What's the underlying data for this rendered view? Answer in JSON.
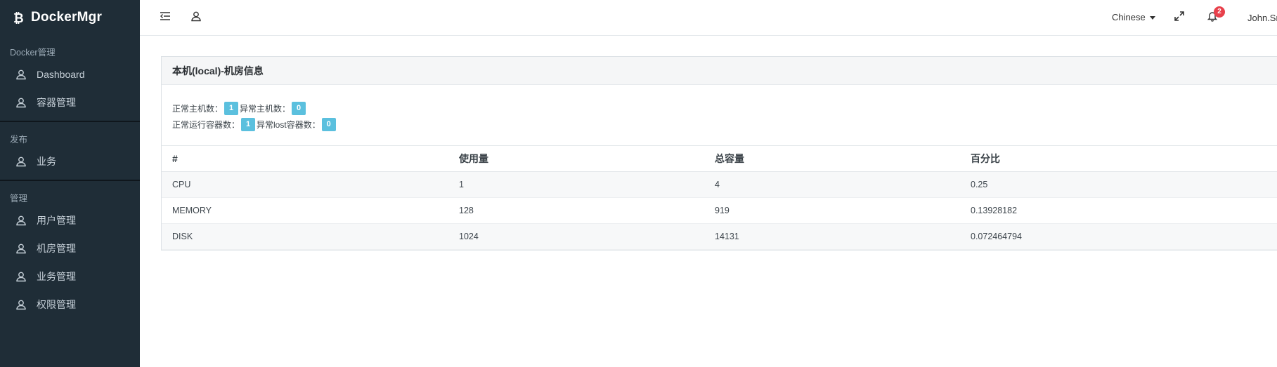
{
  "app": {
    "brand": "DockerMgr"
  },
  "sidebar": {
    "sections": [
      {
        "heading": "Docker管理",
        "items": [
          "Dashboard",
          "容器管理"
        ]
      },
      {
        "heading": "发布",
        "items": [
          "业务"
        ]
      },
      {
        "heading": "管理",
        "items": [
          "用户管理",
          "机房管理",
          "业务管理",
          "权限管理"
        ]
      }
    ]
  },
  "topbar": {
    "language": "Chinese",
    "notifications": "2",
    "user": "John.Sr"
  },
  "card": {
    "title": "本机(local)-机房信息",
    "stats": {
      "normal_hosts_label": "正常主机数：",
      "normal_hosts": "1",
      "abnormal_hosts_label": "异常主机数：",
      "abnormal_hosts": "0",
      "running_containers_label": "正常运行容器数：",
      "running_containers": "1",
      "lost_containers_label": "异常lost容器数：",
      "lost_containers": "0"
    },
    "table": {
      "headers": [
        "#",
        "使用量",
        "总容量",
        "百分比"
      ],
      "rows": [
        [
          "CPU",
          "1",
          "4",
          "0.25"
        ],
        [
          "MEMORY",
          "128",
          "919",
          "0.13928182"
        ],
        [
          "DISK",
          "1024",
          "14131",
          "0.072464794"
        ]
      ]
    }
  }
}
